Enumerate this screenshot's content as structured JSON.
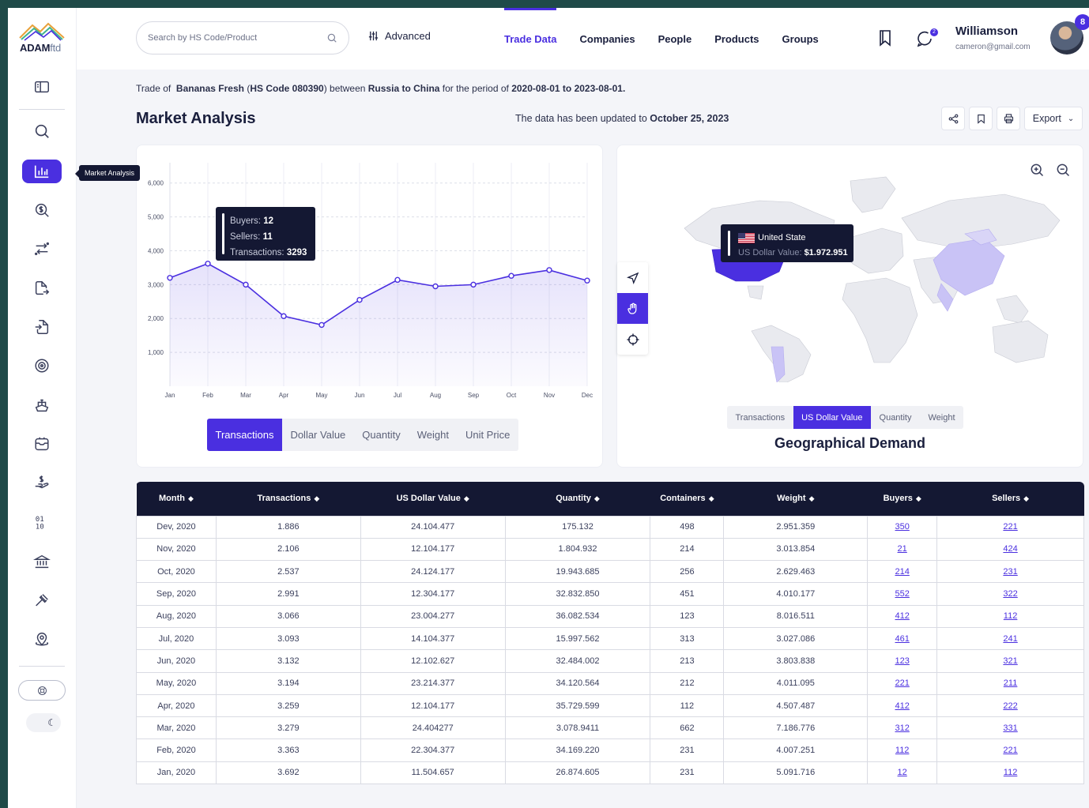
{
  "app": {
    "logo_main": "ADAM",
    "logo_suffix": "ftd"
  },
  "sidebar": {
    "tooltip": "Market Analysis",
    "items": [
      {
        "name": "panel-toggle-icon"
      },
      {
        "name": "search-icon"
      },
      {
        "name": "market-analysis-icon",
        "active": true
      },
      {
        "name": "price-search-icon"
      },
      {
        "name": "transfer-icon"
      },
      {
        "name": "export-doc-icon"
      },
      {
        "name": "import-doc-icon"
      },
      {
        "name": "target-icon"
      },
      {
        "name": "ship-icon"
      },
      {
        "name": "inventory-icon"
      },
      {
        "name": "payment-hand-icon"
      },
      {
        "name": "binary-icon"
      },
      {
        "name": "bank-icon"
      },
      {
        "name": "auction-icon"
      },
      {
        "name": "location-icon"
      }
    ]
  },
  "header": {
    "search_placeholder": "Search by HS Code/Product",
    "advanced_label": "Advanced",
    "nav": [
      {
        "label": "Trade Data",
        "active": true
      },
      {
        "label": "Companies"
      },
      {
        "label": "People"
      },
      {
        "label": "Products"
      },
      {
        "label": "Groups"
      }
    ],
    "notification_count": "2",
    "user_name": "Williamson",
    "user_email": "cameron@gmail.com",
    "avatar_badge": "8"
  },
  "summary": {
    "prefix": "Trade of",
    "product": "Bananas Fresh",
    "hs_open": "(",
    "hs_code": "HS Code 080390",
    "hs_close": ")",
    "between": "between",
    "route": "Russia to China",
    "period_label": "for the period of",
    "period": "2020-08-01 to 2023-08-01",
    "period_end": "."
  },
  "page": {
    "title": "Market Analysis",
    "updated_prefix": "The data has been updated to",
    "updated_date": "October 25, 2023",
    "export_label": "Export"
  },
  "chart_data": {
    "type": "line",
    "categories": [
      "Jan",
      "Feb",
      "Mar",
      "Apr",
      "May",
      "Jun",
      "Jul",
      "Aug",
      "Sep",
      "Oct",
      "Nov",
      "Dec"
    ],
    "values": [
      3200,
      3620,
      3000,
      2070,
      1810,
      2550,
      3140,
      2950,
      3000,
      3260,
      3430,
      3120
    ],
    "yticks": [
      "1,000",
      "2,000",
      "3,000",
      "4,000",
      "5,000",
      "6,000"
    ],
    "ylim": [
      0,
      6600
    ],
    "color": "#4a2fe0",
    "grid": true
  },
  "chart_tooltip": {
    "buyers_label": "Buyers:",
    "buyers_value": "12",
    "sellers_label": "Sellers:",
    "sellers_value": "11",
    "transactions_label": "Transactions:",
    "transactions_value": "3293"
  },
  "chart_tabs": [
    {
      "label": "Transactions",
      "active": true
    },
    {
      "label": "Dollar Value"
    },
    {
      "label": "Quantity"
    },
    {
      "label": "Weight"
    },
    {
      "label": "Unit Price"
    }
  ],
  "map": {
    "title": "Geographical Demand",
    "tooltip_country": "United State",
    "tooltip_label": "US Dollar Value:",
    "tooltip_value": "$1.972.951",
    "tabs": [
      {
        "label": "Transactions"
      },
      {
        "label": "US Dollar Value",
        "active": true
      },
      {
        "label": "Quantity"
      },
      {
        "label": "Weight"
      }
    ],
    "highlight_color": "#4a2fe0",
    "light_color": "#c9c3f6",
    "base_color": "#e9eaef"
  },
  "table": {
    "headers": [
      "Month",
      "Transactions",
      "US Dollar Value",
      "Quantity",
      "Containers",
      "Weight",
      "Buyers",
      "Sellers"
    ],
    "rows": [
      [
        "Dev, 2020",
        "1.886",
        "24.104.477",
        "175.132",
        "498",
        "2.951.359",
        "350",
        "221"
      ],
      [
        "Nov, 2020",
        "2.106",
        "12.104.177",
        "1.804.932",
        "214",
        "3.013.854",
        "21",
        "424"
      ],
      [
        "Oct, 2020",
        "2.537",
        "24.124.177",
        "19.943.685",
        "256",
        "2.629.463",
        "214",
        "231"
      ],
      [
        "Sep, 2020",
        "2.991",
        "12.304.177",
        "32.832.850",
        "451",
        "4.010.177",
        "552",
        "322"
      ],
      [
        "Aug, 2020",
        "3.066",
        "23.004.277",
        "36.082.534",
        "123",
        "8.016.511",
        "412",
        "112"
      ],
      [
        "Jul, 2020",
        "3.093",
        "14.104.377",
        "15.997.562",
        "313",
        "3.027.086",
        "461",
        "241"
      ],
      [
        "Jun, 2020",
        "3.132",
        "12.102.627",
        "32.484.002",
        "213",
        "3.803.838",
        "123",
        "321"
      ],
      [
        "May, 2020",
        "3.194",
        "23.214.377",
        "34.120.564",
        "212",
        "4.011.095",
        "221",
        "211"
      ],
      [
        "Apr, 2020",
        "3.259",
        "12.104.177",
        "35.729.599",
        "112",
        "4.507.487",
        "412",
        "222"
      ],
      [
        "Mar, 2020",
        "3.279",
        "24.404277",
        "3.078.9411",
        "662",
        "7.186.776",
        "312",
        "331"
      ],
      [
        "Feb, 2020",
        "3.363",
        "22.304.377",
        "34.169.220",
        "231",
        "4.007.251",
        "112",
        "221"
      ],
      [
        "Jan, 2020",
        "3.692",
        "11.504.657",
        "26.874.605",
        "231",
        "5.091.716",
        "12",
        "112"
      ]
    ]
  }
}
